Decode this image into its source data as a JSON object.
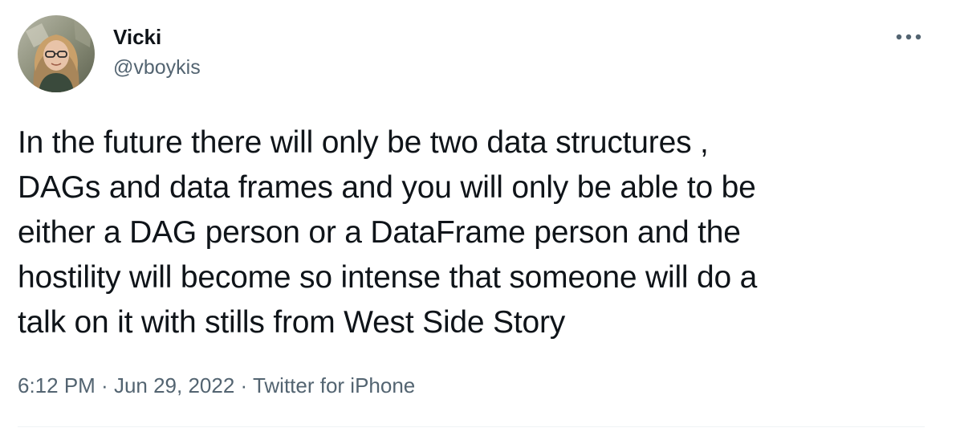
{
  "author": {
    "display_name": "Vicki",
    "handle": "@vboykis"
  },
  "tweet": {
    "text": "In the future there will only be two data structures ,\nDAGs and data frames and you will only be able to be\neither a DAG person or a DataFrame person and the\nhostility will become so intense that someone will do a\ntalk on it with stills from West Side Story"
  },
  "meta": {
    "time": "6:12 PM",
    "separator": " · ",
    "date": "Jun 29, 2022",
    "source": "Twitter for iPhone"
  },
  "icons": {
    "more": "more-horizontal-icon",
    "avatar": "profile-photo"
  },
  "colors": {
    "text_primary": "#0f1419",
    "text_secondary": "#536471",
    "divider": "#eff3f4",
    "background": "#ffffff"
  }
}
